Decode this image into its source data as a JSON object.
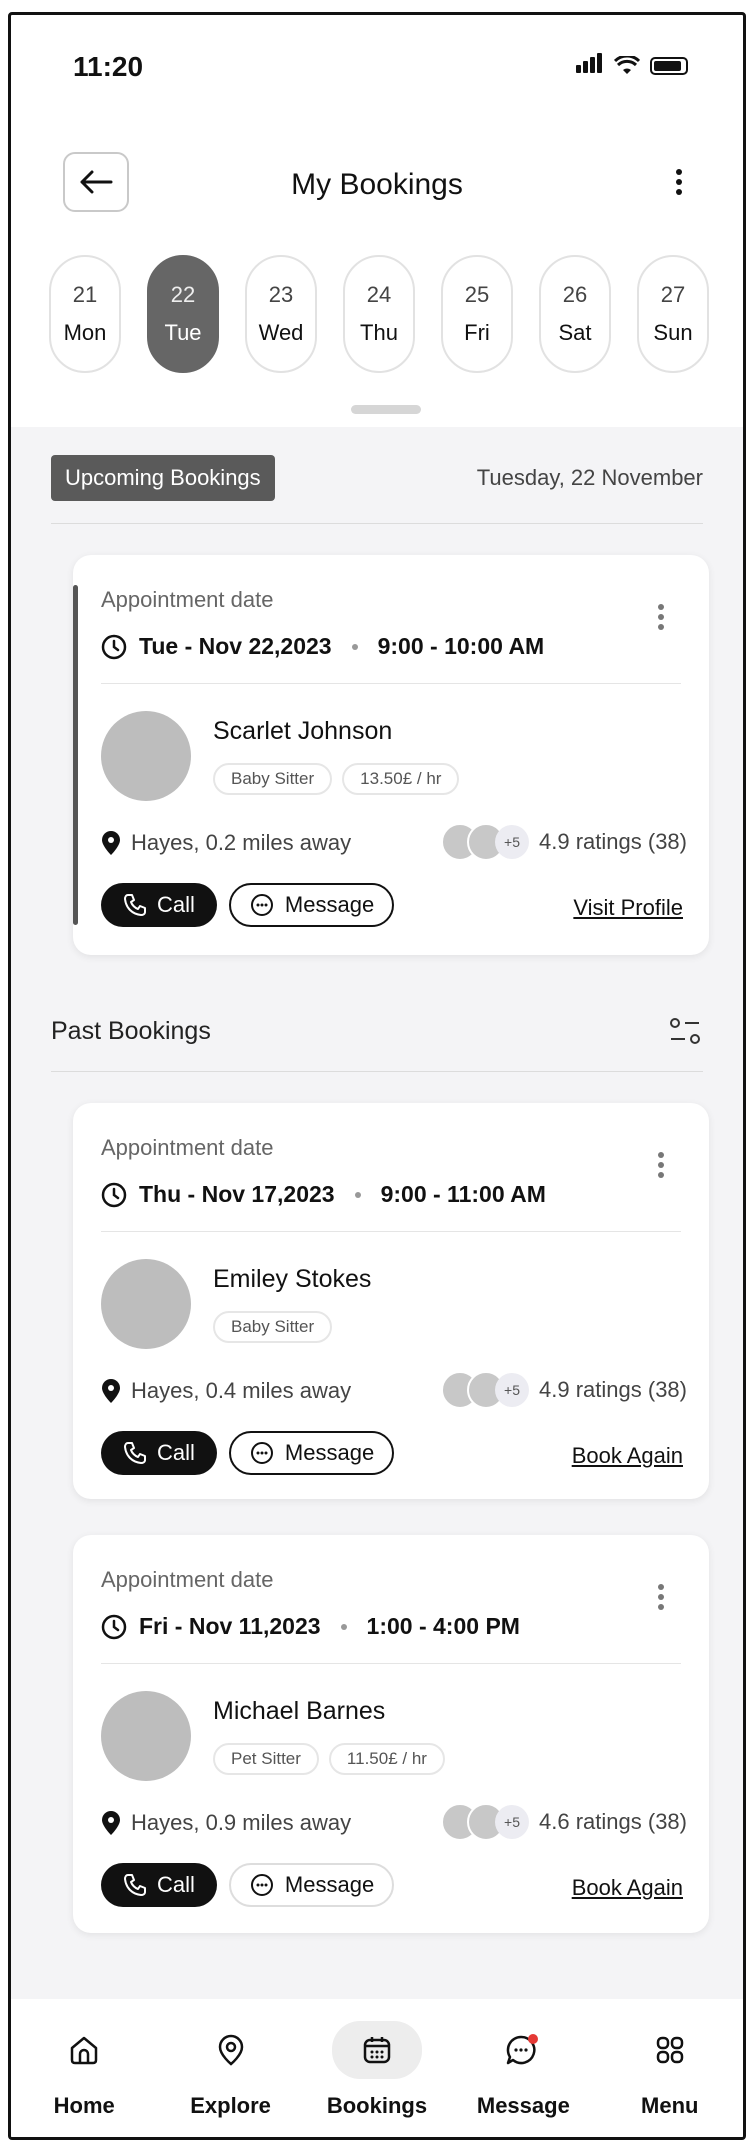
{
  "status": {
    "time": "11:20"
  },
  "header": {
    "title": "My Bookings"
  },
  "dates": [
    {
      "day": "21",
      "weekday": "Mon",
      "active": false
    },
    {
      "day": "22",
      "weekday": "Tue",
      "active": true
    },
    {
      "day": "23",
      "weekday": "Wed",
      "active": false
    },
    {
      "day": "24",
      "weekday": "Thu",
      "active": false
    },
    {
      "day": "25",
      "weekday": "Fri",
      "active": false
    },
    {
      "day": "26",
      "weekday": "Sat",
      "active": false
    },
    {
      "day": "27",
      "weekday": "Sun",
      "active": false
    }
  ],
  "upcoming": {
    "badge": "Upcoming Bookings",
    "date": "Tuesday, 22 November",
    "card": {
      "label": "Appointment date",
      "date": "Tue - Nov 22,2023",
      "time": "9:00 - 10:00 AM",
      "name": "Scarlet Johnson",
      "tags": [
        "Baby Sitter",
        "13.50£ / hr"
      ],
      "location": "Hayes, 0.2 miles away",
      "plus": "+5",
      "rating": "4.9 ratings (38)",
      "call": "Call",
      "message": "Message",
      "link": "Visit Profile"
    }
  },
  "past": {
    "title": "Past Bookings",
    "cards": [
      {
        "label": "Appointment date",
        "date": "Thu - Nov 17,2023",
        "time": "9:00 - 11:00 AM",
        "name": "Emiley Stokes",
        "tags": [
          "Baby Sitter"
        ],
        "location": "Hayes, 0.4 miles away",
        "plus": "+5",
        "rating": "4.9 ratings (38)",
        "call": "Call",
        "message": "Message",
        "link": "Book Again"
      },
      {
        "label": "Appointment date",
        "date": "Fri - Nov 11,2023",
        "time": "1:00 - 4:00 PM",
        "name": "Michael Barnes",
        "tags": [
          "Pet Sitter",
          "11.50£ / hr"
        ],
        "location": "Hayes, 0.9 miles away",
        "plus": "+5",
        "rating": "4.6 ratings (38)",
        "call": "Call",
        "message": "Message",
        "link": "Book Again"
      }
    ]
  },
  "nav": [
    {
      "label": "Home",
      "icon": "home-icon"
    },
    {
      "label": "Explore",
      "icon": "location-icon"
    },
    {
      "label": "Bookings",
      "icon": "calendar-icon",
      "active": true
    },
    {
      "label": "Message",
      "icon": "chat-icon"
    },
    {
      "label": "Menu",
      "icon": "grid-icon"
    }
  ],
  "colors": {
    "accent": "#555555",
    "active_pill": "#666666",
    "badge": "#5a5a5a",
    "notification": "#e53935"
  }
}
